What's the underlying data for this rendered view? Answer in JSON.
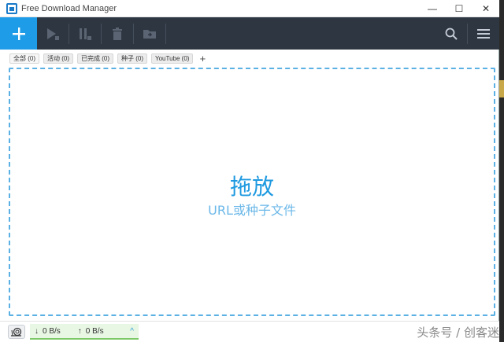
{
  "window": {
    "title": "Free Download Manager"
  },
  "controls": {
    "minimize": "—",
    "maximize": "☐",
    "close": "✕"
  },
  "toolbar": {
    "buttons": [
      {
        "icon": "plus-icon",
        "label": "add"
      },
      {
        "icon": "play-icon",
        "label": "resume"
      },
      {
        "icon": "pause-icon",
        "label": "pause"
      },
      {
        "icon": "trash-icon",
        "label": "delete"
      },
      {
        "icon": "folder-icon",
        "label": "move"
      },
      {
        "icon": "search-icon",
        "label": "search"
      },
      {
        "icon": "menu-icon",
        "label": "menu"
      }
    ]
  },
  "tabs": [
    {
      "label": "全部 (0)"
    },
    {
      "label": "活动 (0)"
    },
    {
      "label": "已完成 (0)"
    },
    {
      "label": "种子 (0)"
    },
    {
      "label": "YouTube (0)"
    }
  ],
  "tab_add": "+",
  "dropzone": {
    "title": "拖放",
    "subtitle": "URL或种子文件"
  },
  "status": {
    "download_speed": "0 B/s",
    "upload_speed": "0 B/s",
    "down_arrow": "↓",
    "up_arrow": "↑",
    "expand": "^"
  },
  "watermark": "头条号 / 创客迷",
  "colors": {
    "accent": "#1e9ce8",
    "toolbar_bg": "#2e3642",
    "dash": "#5bb0e4"
  }
}
